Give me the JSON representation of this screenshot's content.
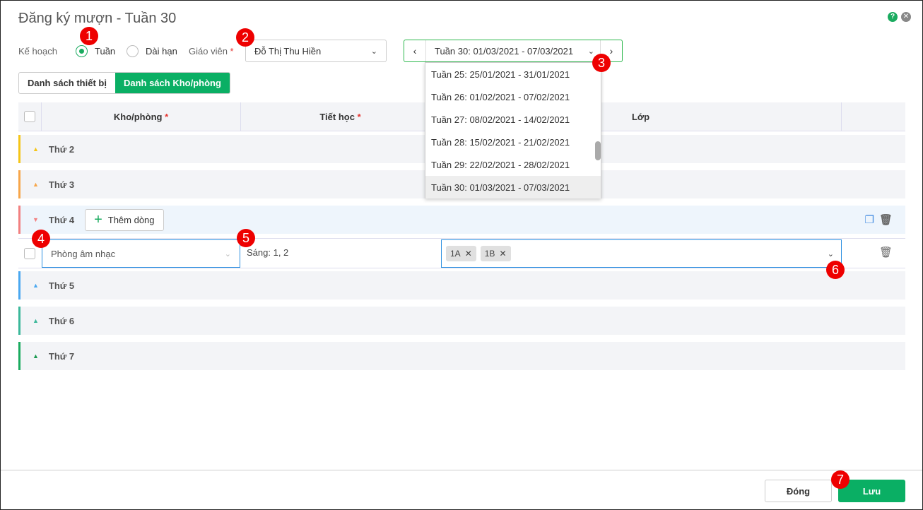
{
  "title": "Đăng ký mượn - Tuần 30",
  "plan": {
    "label": "Kế hoạch",
    "options": [
      "Tuần",
      "Dài hạn"
    ],
    "selected": "Tuần"
  },
  "teacher": {
    "label": "Giáo viên",
    "required": "*",
    "value": "Đỗ Thị Thu Hiền"
  },
  "week": {
    "value": "Tuần 30: 01/03/2021 - 07/03/2021",
    "options": [
      "Tuần 25: 25/01/2021 - 31/01/2021",
      "Tuần 26: 01/02/2021 - 07/02/2021",
      "Tuần 27: 08/02/2021 - 14/02/2021",
      "Tuần 28: 15/02/2021 - 21/02/2021",
      "Tuần 29: 22/02/2021 - 28/02/2021",
      "Tuần 30: 01/03/2021 - 07/03/2021"
    ]
  },
  "tabs": [
    "Danh sách thiết bị",
    "Danh sách Kho/phòng"
  ],
  "columns": {
    "room": "Kho/phòng",
    "period": "Tiết học",
    "class": "Lớp",
    "req": "*"
  },
  "days": [
    {
      "label": "Thứ 2",
      "color": "#f5c518"
    },
    {
      "label": "Thứ 3",
      "color": "#f7a64a"
    },
    {
      "label": "Thứ 4",
      "color": "#f28080"
    },
    {
      "label": "Thứ 5",
      "color": "#4aa8f0"
    },
    {
      "label": "Thứ 6",
      "color": "#3bb89a"
    },
    {
      "label": "Thứ 7",
      "color": "#1aab5f"
    }
  ],
  "add_row": "Thêm dòng",
  "row": {
    "room": "Phòng âm nhạc",
    "period": "Sáng: 1, 2",
    "classes": [
      "1A",
      "1B"
    ]
  },
  "footer": {
    "close": "Đóng",
    "save": "Lưu"
  },
  "badges": [
    "1",
    "2",
    "3",
    "4",
    "5",
    "6",
    "7"
  ]
}
